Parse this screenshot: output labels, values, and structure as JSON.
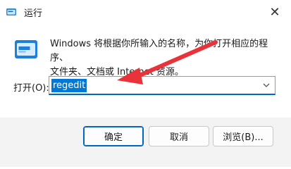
{
  "window": {
    "title": "运行",
    "close_glyph": "✕"
  },
  "description": {
    "line1": "Windows 将根据你所输入的名称，为你打开相应的程序、",
    "line2": "文件夹、文档或 Internet 资源。"
  },
  "open_field": {
    "label": "打开(O):",
    "value": "regedit"
  },
  "buttons": {
    "ok": "确定",
    "cancel": "取消",
    "browse": "浏览(B)..."
  },
  "colors": {
    "accent": "#0067c0",
    "selection": "#0078d7",
    "annotation_arrow": "#e8333a"
  },
  "icons": {
    "app": "run-app-icon",
    "run": "run-icon",
    "close": "close-icon",
    "dropdown": "chevron-down-icon"
  }
}
